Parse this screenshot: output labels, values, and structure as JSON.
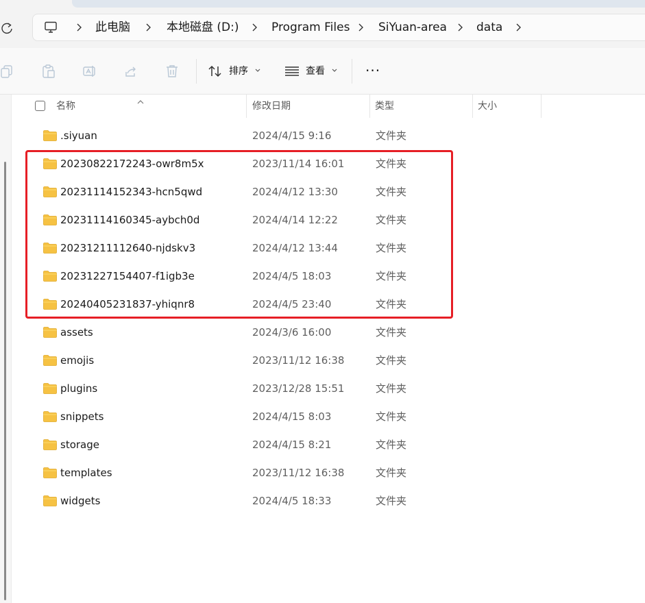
{
  "breadcrumb": [
    "此电脑",
    "本地磁盘 (D:)",
    "Program Files",
    "SiYuan-area",
    "data"
  ],
  "toolbar": {
    "sort_label": "排序",
    "view_label": "查看",
    "more_label": "···"
  },
  "columns": {
    "name": "名称",
    "date": "修改日期",
    "type": "类型",
    "size": "大小"
  },
  "rows": [
    {
      "name": ".siyuan",
      "date": "2024/4/15 9:16",
      "type": "文件夹"
    },
    {
      "name": "20230822172243-owr8m5x",
      "date": "2023/11/14 16:01",
      "type": "文件夹"
    },
    {
      "name": "20231114152343-hcn5qwd",
      "date": "2024/4/12 13:30",
      "type": "文件夹"
    },
    {
      "name": "20231114160345-aybch0d",
      "date": "2024/4/14 12:22",
      "type": "文件夹"
    },
    {
      "name": "20231211112640-njdskv3",
      "date": "2024/4/12 13:44",
      "type": "文件夹"
    },
    {
      "name": "20231227154407-f1igb3e",
      "date": "2024/4/5 18:03",
      "type": "文件夹"
    },
    {
      "name": "20240405231837-yhiqnr8",
      "date": "2024/4/5 23:40",
      "type": "文件夹"
    },
    {
      "name": "assets",
      "date": "2024/3/6 16:00",
      "type": "文件夹"
    },
    {
      "name": "emojis",
      "date": "2023/11/12 16:38",
      "type": "文件夹"
    },
    {
      "name": "plugins",
      "date": "2023/12/28 15:51",
      "type": "文件夹"
    },
    {
      "name": "snippets",
      "date": "2024/4/15 8:03",
      "type": "文件夹"
    },
    {
      "name": "storage",
      "date": "2024/4/15 8:21",
      "type": "文件夹"
    },
    {
      "name": "templates",
      "date": "2023/11/12 16:38",
      "type": "文件夹"
    },
    {
      "name": "widgets",
      "date": "2024/4/5 18:33",
      "type": "文件夹"
    }
  ],
  "colors": {
    "highlight": "#e61e25",
    "folder": "#f6c243"
  },
  "icons": [
    "refresh-icon",
    "computer-icon",
    "copy-icon",
    "paste-icon",
    "rename-icon",
    "share-icon",
    "delete-icon",
    "sort-icon",
    "view-icon",
    "more-icon",
    "folder-icon"
  ]
}
